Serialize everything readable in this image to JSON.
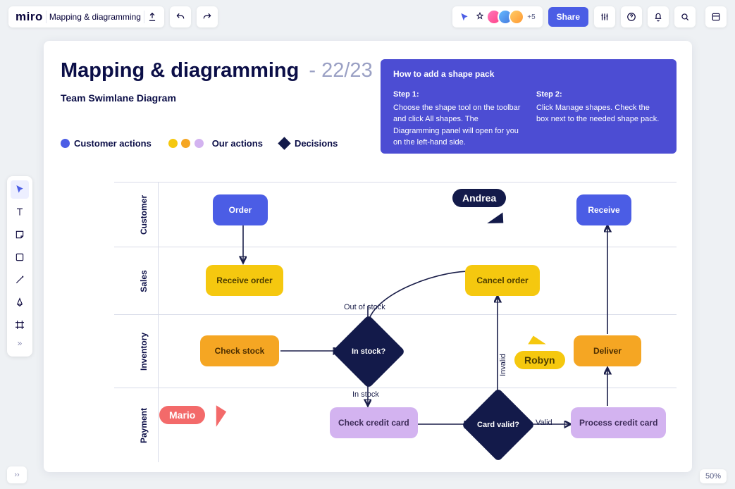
{
  "app": {
    "logo": "miro",
    "board_name": "Mapping & diagramming"
  },
  "topbar": {
    "avatars_more": "+5",
    "share_label": "Share"
  },
  "footer": {
    "zoom": "50%",
    "hide": "››"
  },
  "tools": [
    "cursor",
    "text",
    "sticky",
    "shape",
    "line",
    "pen",
    "frame",
    "more"
  ],
  "board": {
    "title": "Mapping & diagramming",
    "title_suffix": "- 22/23",
    "subtitle": "Team Swimlane Diagram"
  },
  "legend": {
    "customer": "Customer actions",
    "our": "Our actions",
    "dec": "Decisions"
  },
  "help": {
    "title": "How to add a shape pack",
    "step1_h": "Step 1:",
    "step1": "Choose the shape tool on the toolbar and click All shapes. The Diagramming panel will open for you on the left-hand side.",
    "step2_h": "Step 2:",
    "step2": "Click Manage shapes. Check the box next to the needed shape pack."
  },
  "lanes": [
    "Customer",
    "Sales",
    "Inventory",
    "Payment"
  ],
  "nodes": {
    "order": "Order",
    "receive": "Receive",
    "receive_order": "Receive order",
    "cancel_order": "Cancel order",
    "check_stock": "Check stock",
    "in_stock_q": "In stock?",
    "deliver": "Deliver",
    "check_cc": "Check credit card",
    "card_valid_q": "Card valid?",
    "process_cc": "Process credit card"
  },
  "edges": {
    "out_of_stock": "Out of stock",
    "in_stock": "In stock",
    "invalid": "Invalid",
    "valid": "Valid"
  },
  "cursors": {
    "andrea": "Andrea",
    "robyn": "Robyn",
    "mario": "Mario"
  },
  "legend_colors": {
    "customer": "#4b5de5",
    "our1": "#f5c80f",
    "our2": "#f5a623",
    "our3": "#d3b3f0",
    "dec": "#131a4a"
  }
}
